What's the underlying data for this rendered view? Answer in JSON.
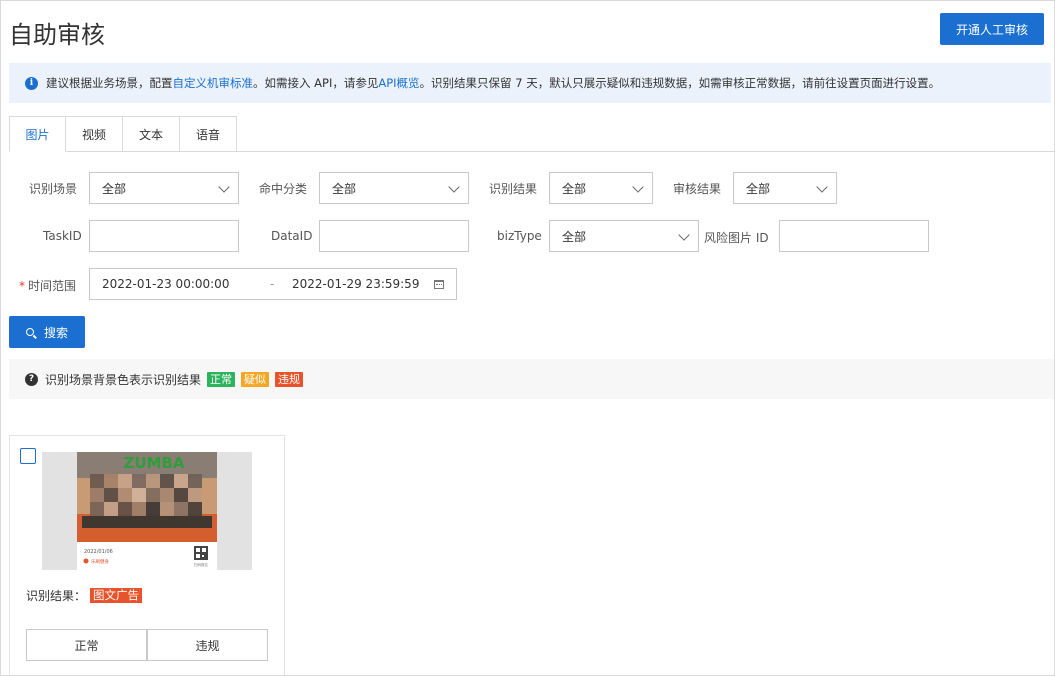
{
  "header": {
    "title": "自助审核",
    "open_button": "开通人工审核"
  },
  "notice": {
    "part1": "建议根据业务场景，配置 ",
    "link1": "自定义机审标准",
    "part2": "。如需接入 API，请参见 ",
    "link2": "API概览",
    "part3": "。识别结果只保留 7 天，默认只展示疑似和违规数据，如需审核正常数据，请前往设置页面进行设置。"
  },
  "tabs": [
    "图片",
    "视频",
    "文本",
    "语音"
  ],
  "filters": {
    "scene": {
      "label": "识别场景",
      "value": "全部"
    },
    "category": {
      "label": "命中分类",
      "value": "全部"
    },
    "result": {
      "label": "识别结果",
      "value": "全部"
    },
    "review": {
      "label": "审核结果",
      "value": "全部"
    },
    "taskid": {
      "label": "TaskID",
      "value": ""
    },
    "dataid": {
      "label": "DataID",
      "value": ""
    },
    "biztype": {
      "label": "bizType",
      "value": "全部"
    },
    "risk_image_id": {
      "label": "风险图片 ID",
      "value": ""
    },
    "time_range": {
      "label": "时间范围",
      "required_mark": "*",
      "start": "2022-01-23 00:00:00",
      "separator": "-",
      "end": "2022-01-29 23:59:59"
    }
  },
  "search_button": "搜索",
  "legend": {
    "text": "识别场景背景色表示识别结果",
    "badges": [
      {
        "label": "正常",
        "color": "#2db35d"
      },
      {
        "label": "疑似",
        "color": "#f5a623"
      },
      {
        "label": "违规",
        "color": "#e8532b"
      }
    ]
  },
  "card": {
    "thumbnail_text": {
      "banner": "ZUMBA",
      "date": "2022/01/06",
      "brand": "乐刷健身",
      "qr_caption": "扫码报名"
    },
    "result_label": "识别结果：",
    "result_tag": "图文广告",
    "normal_button": "正常",
    "violation_button": "违规"
  },
  "colors": {
    "primary": "#1b6fd0",
    "notice_bg": "#ebf2fb",
    "legend_bg": "#f7f7f7",
    "tag_red": "#e8532b"
  }
}
